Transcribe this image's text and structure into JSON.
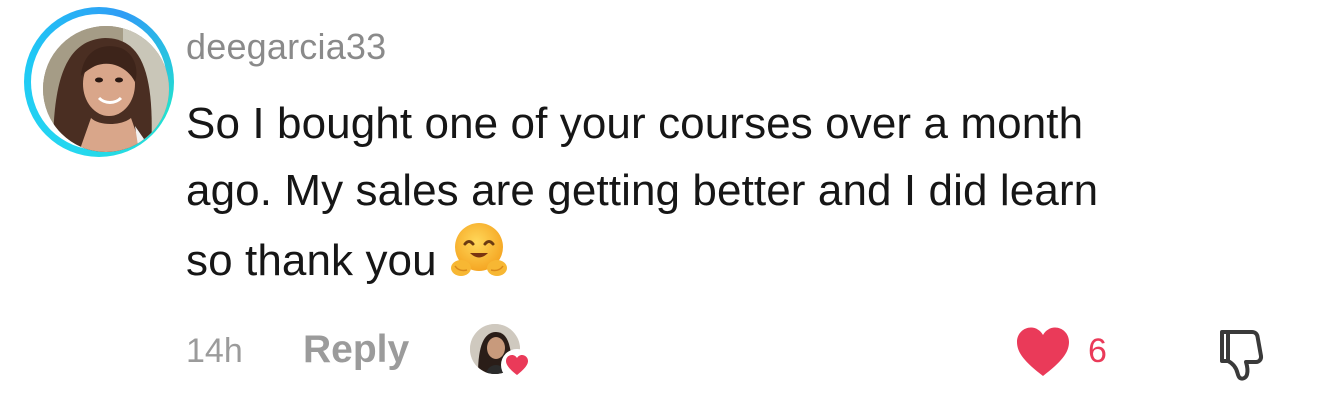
{
  "comment": {
    "username": "deegarcia33",
    "text_lines": [
      "So I bought one of your courses over a month",
      "ago. My sales are getting better and I did learn",
      "so thank you"
    ],
    "emoji": "hugging-face",
    "timestamp": "14h",
    "reply_label": "Reply",
    "like_count": "6",
    "liked_by_creator": true
  },
  "colors": {
    "username": "#8a8a8a",
    "text": "#161616",
    "meta": "#9b9b9b",
    "heart": "#ea3a59",
    "avatar_ring": "#25d7f0"
  },
  "icons": {
    "like": "heart-icon",
    "dislike": "thumbs-down-icon",
    "creator_like": "heart-badge-icon"
  }
}
